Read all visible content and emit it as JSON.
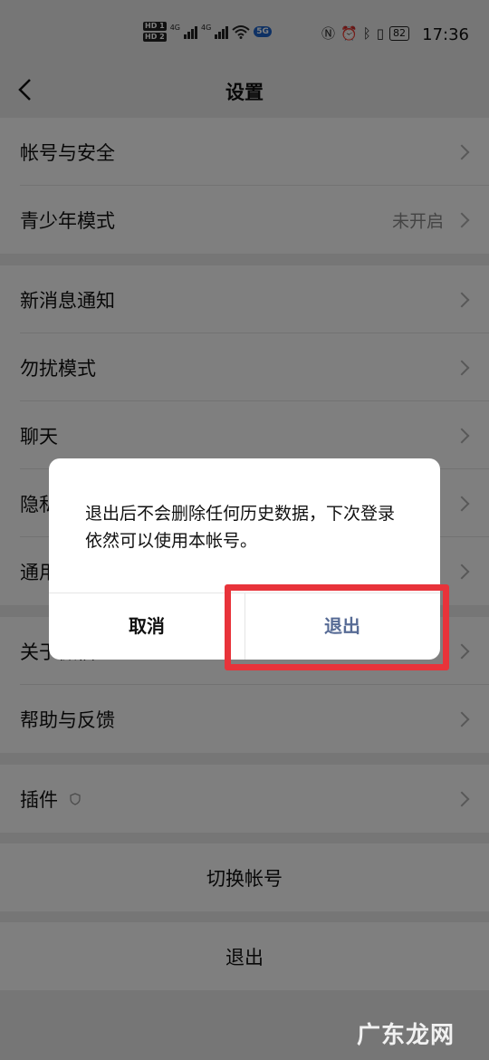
{
  "status_bar": {
    "time": "17:36",
    "battery": "82",
    "network_badge": "5G",
    "hd1": "HD 1",
    "hd2": "HD 2",
    "net1": "4G",
    "net2": "4G"
  },
  "nav": {
    "title": "设置"
  },
  "sections": {
    "account_security": "帐号与安全",
    "teen_mode": "青少年模式",
    "teen_mode_value": "未开启",
    "new_message": "新消息通知",
    "do_not_disturb": "勿扰模式",
    "chat": "聊天",
    "privacy": "隐私",
    "general": "通用",
    "about": "关于微信",
    "help": "帮助与反馈",
    "plugins": "插件",
    "switch_account": "切换帐号",
    "logout": "退出"
  },
  "dialog": {
    "message": "退出后不会删除任何历史数据，下次登录依然可以使用本帐号。",
    "cancel": "取消",
    "confirm": "退出"
  },
  "watermark": "广东龙网",
  "colors": {
    "dialog_confirm": "#576b95",
    "highlight": "#e8333a"
  }
}
